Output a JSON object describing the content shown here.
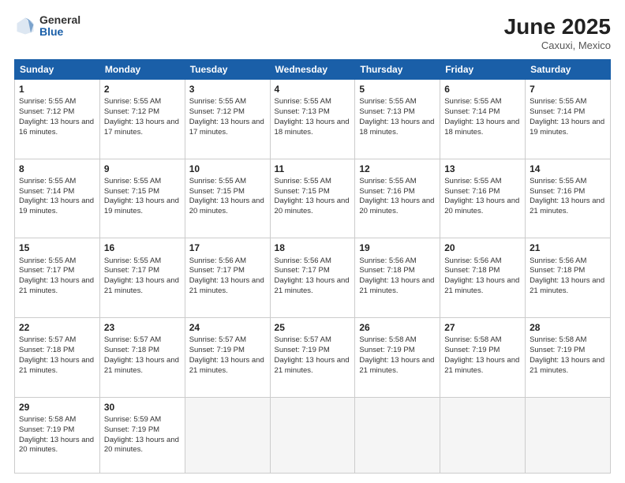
{
  "header": {
    "logo_general": "General",
    "logo_blue": "Blue",
    "month": "June 2025",
    "location": "Caxuxi, Mexico"
  },
  "days_of_week": [
    "Sunday",
    "Monday",
    "Tuesday",
    "Wednesday",
    "Thursday",
    "Friday",
    "Saturday"
  ],
  "weeks": [
    [
      {
        "day": "1",
        "sunrise": "Sunrise: 5:55 AM",
        "sunset": "Sunset: 7:12 PM",
        "daylight": "Daylight: 13 hours and 16 minutes."
      },
      {
        "day": "2",
        "sunrise": "Sunrise: 5:55 AM",
        "sunset": "Sunset: 7:12 PM",
        "daylight": "Daylight: 13 hours and 17 minutes."
      },
      {
        "day": "3",
        "sunrise": "Sunrise: 5:55 AM",
        "sunset": "Sunset: 7:12 PM",
        "daylight": "Daylight: 13 hours and 17 minutes."
      },
      {
        "day": "4",
        "sunrise": "Sunrise: 5:55 AM",
        "sunset": "Sunset: 7:13 PM",
        "daylight": "Daylight: 13 hours and 18 minutes."
      },
      {
        "day": "5",
        "sunrise": "Sunrise: 5:55 AM",
        "sunset": "Sunset: 7:13 PM",
        "daylight": "Daylight: 13 hours and 18 minutes."
      },
      {
        "day": "6",
        "sunrise": "Sunrise: 5:55 AM",
        "sunset": "Sunset: 7:14 PM",
        "daylight": "Daylight: 13 hours and 18 minutes."
      },
      {
        "day": "7",
        "sunrise": "Sunrise: 5:55 AM",
        "sunset": "Sunset: 7:14 PM",
        "daylight": "Daylight: 13 hours and 19 minutes."
      }
    ],
    [
      {
        "day": "8",
        "sunrise": "Sunrise: 5:55 AM",
        "sunset": "Sunset: 7:14 PM",
        "daylight": "Daylight: 13 hours and 19 minutes."
      },
      {
        "day": "9",
        "sunrise": "Sunrise: 5:55 AM",
        "sunset": "Sunset: 7:15 PM",
        "daylight": "Daylight: 13 hours and 19 minutes."
      },
      {
        "day": "10",
        "sunrise": "Sunrise: 5:55 AM",
        "sunset": "Sunset: 7:15 PM",
        "daylight": "Daylight: 13 hours and 20 minutes."
      },
      {
        "day": "11",
        "sunrise": "Sunrise: 5:55 AM",
        "sunset": "Sunset: 7:15 PM",
        "daylight": "Daylight: 13 hours and 20 minutes."
      },
      {
        "day": "12",
        "sunrise": "Sunrise: 5:55 AM",
        "sunset": "Sunset: 7:16 PM",
        "daylight": "Daylight: 13 hours and 20 minutes."
      },
      {
        "day": "13",
        "sunrise": "Sunrise: 5:55 AM",
        "sunset": "Sunset: 7:16 PM",
        "daylight": "Daylight: 13 hours and 20 minutes."
      },
      {
        "day": "14",
        "sunrise": "Sunrise: 5:55 AM",
        "sunset": "Sunset: 7:16 PM",
        "daylight": "Daylight: 13 hours and 21 minutes."
      }
    ],
    [
      {
        "day": "15",
        "sunrise": "Sunrise: 5:55 AM",
        "sunset": "Sunset: 7:17 PM",
        "daylight": "Daylight: 13 hours and 21 minutes."
      },
      {
        "day": "16",
        "sunrise": "Sunrise: 5:55 AM",
        "sunset": "Sunset: 7:17 PM",
        "daylight": "Daylight: 13 hours and 21 minutes."
      },
      {
        "day": "17",
        "sunrise": "Sunrise: 5:56 AM",
        "sunset": "Sunset: 7:17 PM",
        "daylight": "Daylight: 13 hours and 21 minutes."
      },
      {
        "day": "18",
        "sunrise": "Sunrise: 5:56 AM",
        "sunset": "Sunset: 7:17 PM",
        "daylight": "Daylight: 13 hours and 21 minutes."
      },
      {
        "day": "19",
        "sunrise": "Sunrise: 5:56 AM",
        "sunset": "Sunset: 7:18 PM",
        "daylight": "Daylight: 13 hours and 21 minutes."
      },
      {
        "day": "20",
        "sunrise": "Sunrise: 5:56 AM",
        "sunset": "Sunset: 7:18 PM",
        "daylight": "Daylight: 13 hours and 21 minutes."
      },
      {
        "day": "21",
        "sunrise": "Sunrise: 5:56 AM",
        "sunset": "Sunset: 7:18 PM",
        "daylight": "Daylight: 13 hours and 21 minutes."
      }
    ],
    [
      {
        "day": "22",
        "sunrise": "Sunrise: 5:57 AM",
        "sunset": "Sunset: 7:18 PM",
        "daylight": "Daylight: 13 hours and 21 minutes."
      },
      {
        "day": "23",
        "sunrise": "Sunrise: 5:57 AM",
        "sunset": "Sunset: 7:18 PM",
        "daylight": "Daylight: 13 hours and 21 minutes."
      },
      {
        "day": "24",
        "sunrise": "Sunrise: 5:57 AM",
        "sunset": "Sunset: 7:19 PM",
        "daylight": "Daylight: 13 hours and 21 minutes."
      },
      {
        "day": "25",
        "sunrise": "Sunrise: 5:57 AM",
        "sunset": "Sunset: 7:19 PM",
        "daylight": "Daylight: 13 hours and 21 minutes."
      },
      {
        "day": "26",
        "sunrise": "Sunrise: 5:58 AM",
        "sunset": "Sunset: 7:19 PM",
        "daylight": "Daylight: 13 hours and 21 minutes."
      },
      {
        "day": "27",
        "sunrise": "Sunrise: 5:58 AM",
        "sunset": "Sunset: 7:19 PM",
        "daylight": "Daylight: 13 hours and 21 minutes."
      },
      {
        "day": "28",
        "sunrise": "Sunrise: 5:58 AM",
        "sunset": "Sunset: 7:19 PM",
        "daylight": "Daylight: 13 hours and 21 minutes."
      }
    ],
    [
      {
        "day": "29",
        "sunrise": "Sunrise: 5:58 AM",
        "sunset": "Sunset: 7:19 PM",
        "daylight": "Daylight: 13 hours and 20 minutes."
      },
      {
        "day": "30",
        "sunrise": "Sunrise: 5:59 AM",
        "sunset": "Sunset: 7:19 PM",
        "daylight": "Daylight: 13 hours and 20 minutes."
      },
      {
        "day": "",
        "sunrise": "",
        "sunset": "",
        "daylight": ""
      },
      {
        "day": "",
        "sunrise": "",
        "sunset": "",
        "daylight": ""
      },
      {
        "day": "",
        "sunrise": "",
        "sunset": "",
        "daylight": ""
      },
      {
        "day": "",
        "sunrise": "",
        "sunset": "",
        "daylight": ""
      },
      {
        "day": "",
        "sunrise": "",
        "sunset": "",
        "daylight": ""
      }
    ]
  ]
}
